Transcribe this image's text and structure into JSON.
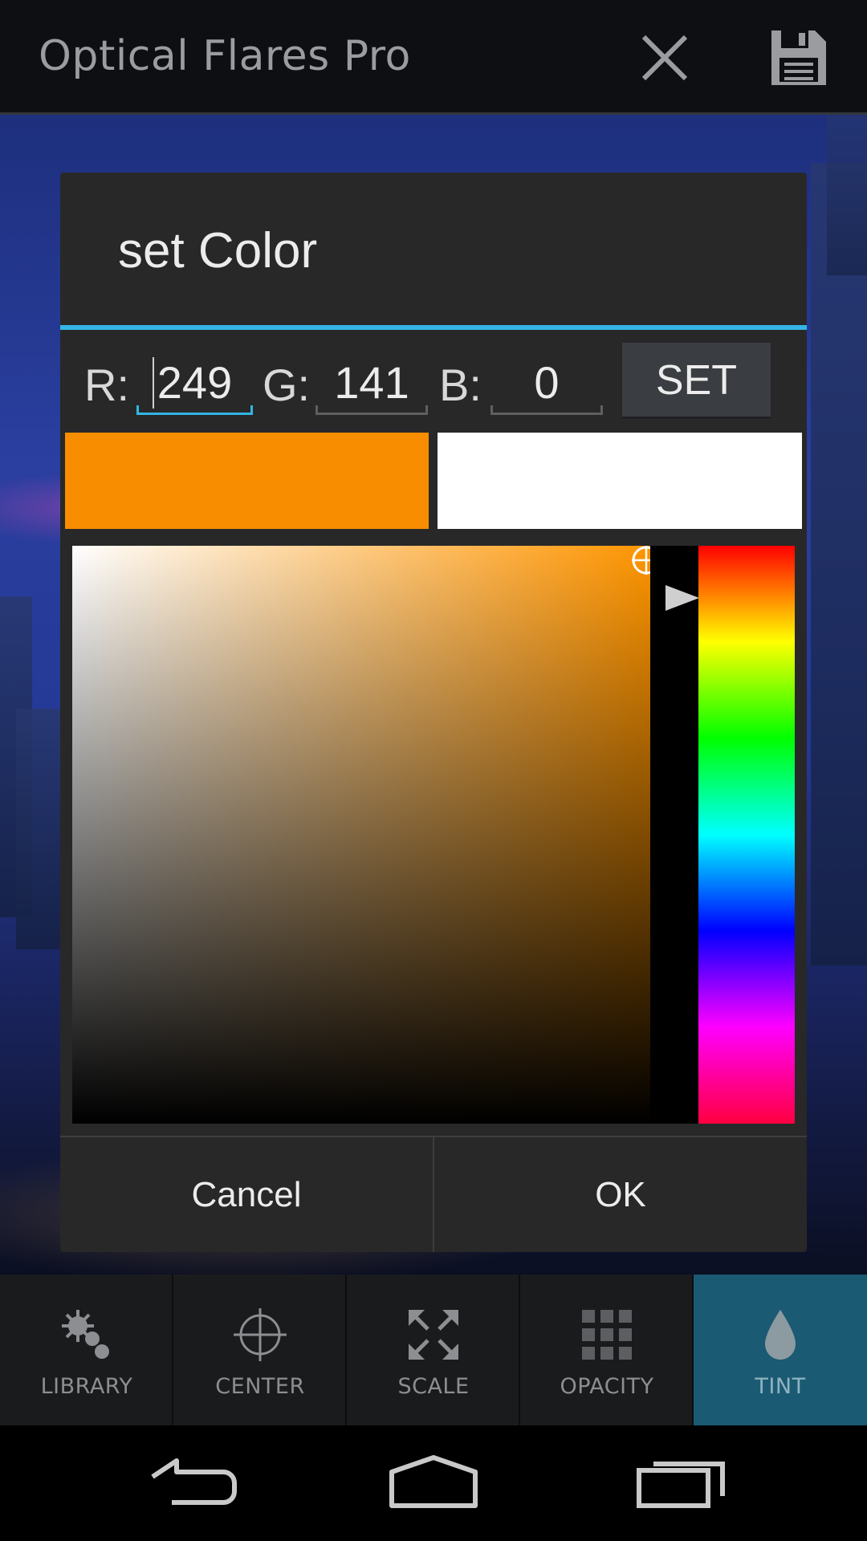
{
  "app": {
    "title": "Optical Flares Pro",
    "close_icon": "close-icon",
    "save_icon": "save-icon"
  },
  "dialog": {
    "title": "set Color",
    "r_label": "R:",
    "g_label": "G:",
    "b_label": "B:",
    "r_value": "249",
    "g_value": "141",
    "b_value": "0",
    "set_label": "SET",
    "new_color": "#f98d00",
    "old_color": "#ffffff",
    "hue_color": "#ff9500",
    "accent_color": "#33b5e5",
    "cancel_label": "Cancel",
    "ok_label": "OK"
  },
  "toolbar": {
    "items": [
      {
        "label": "LIBRARY",
        "icon": "library-icon",
        "active": false
      },
      {
        "label": "CENTER",
        "icon": "crosshair-icon",
        "active": false
      },
      {
        "label": "SCALE",
        "icon": "scale-arrows-icon",
        "active": false
      },
      {
        "label": "OPACITY",
        "icon": "opacity-grid-icon",
        "active": false
      },
      {
        "label": "TINT",
        "icon": "droplet-icon",
        "active": true
      }
    ]
  },
  "navbar": {
    "back_icon": "back-icon",
    "home_icon": "home-icon",
    "recents_icon": "recents-icon"
  }
}
